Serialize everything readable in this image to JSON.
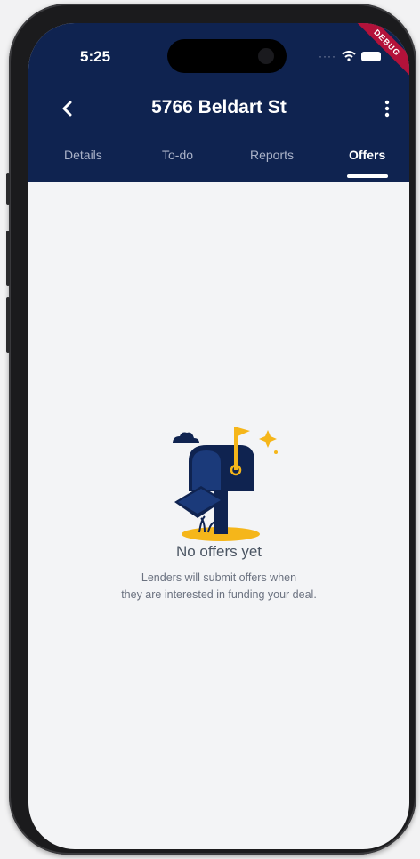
{
  "status_bar": {
    "time": "5:25"
  },
  "debug_banner": "DEBUG",
  "header": {
    "title": "5766 Beldart St"
  },
  "tabs": [
    {
      "label": "Details"
    },
    {
      "label": "To-do"
    },
    {
      "label": "Reports"
    },
    {
      "label": "Offers"
    }
  ],
  "active_tab": "Offers",
  "empty_state": {
    "title": "No offers yet",
    "line1": "Lenders will submit offers when",
    "line2": "they are interested in funding your deal."
  },
  "colors": {
    "header_bg": "#0f2350",
    "accent": "#f5b61a",
    "ribbon": "#b3123a"
  }
}
